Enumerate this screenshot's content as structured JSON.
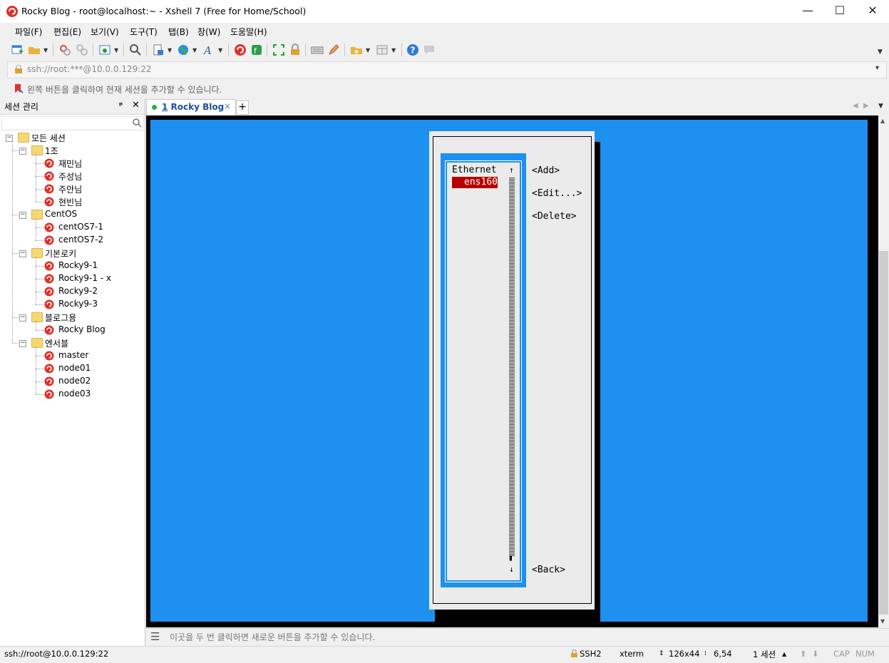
{
  "window": {
    "title": "Rocky Blog - root@localhost:~ - Xshell 7 (Free for Home/School)",
    "minimize": "—",
    "maximize": "☐",
    "close": "✕"
  },
  "menu": [
    "파일(F)",
    "편집(E)",
    "보기(V)",
    "도구(T)",
    "탭(B)",
    "창(W)",
    "도움말(H)"
  ],
  "address": {
    "value": "ssh://root:***@10.0.0.129:22",
    "dropdown": "▾"
  },
  "hint": {
    "text": "왼쪽 버튼을 클릭하여 현재 세션을 추가할 수 있습니다."
  },
  "session_panel": {
    "title": "세션 관리",
    "pin": "ᵖ",
    "close": "✕",
    "root": "모든 세션",
    "groups": [
      {
        "name": "1조",
        "items": [
          "재민님",
          "주성님",
          "주안님",
          "현빈님"
        ]
      },
      {
        "name": "CentOS",
        "items": [
          "centOS7-1",
          "centOS7-2"
        ]
      },
      {
        "name": "기본로키",
        "items": [
          "Rocky9-1",
          "Rocky9-1 - x",
          "Rocky9-2",
          "Rocky9-3"
        ]
      },
      {
        "name": "블로그용",
        "items": [
          "Rocky Blog"
        ]
      },
      {
        "name": "엔서블",
        "items": [
          "master",
          "node01",
          "node02",
          "node03"
        ]
      }
    ]
  },
  "tabs": {
    "active_number": "1",
    "active_label": "Rocky Blog",
    "close": "×",
    "add": "+"
  },
  "terminal": {
    "list_header": "Ethernet",
    "list_item": "ens160",
    "arrow_up": "↑",
    "arrow_down": "↓",
    "scroll_pos_char": "▮",
    "buttons": {
      "add": "<Add>",
      "edit": "<Edit...>",
      "delete": "<Delete>",
      "back": "<Back>"
    }
  },
  "input_bar": {
    "text": "이곳을 두 번 클릭하면 새로운 버튼을 추가할 수 있습니다."
  },
  "status": {
    "connection": "ssh://root@10.0.0.129:22",
    "protocol": "SSH2",
    "term": "xterm",
    "size": "126x44",
    "cursor": "6,54",
    "sessions": "1 세션",
    "cap": "CAP",
    "num": "NUM"
  },
  "colors": {
    "terminal_bg": "#1e90f0",
    "selected": "#b80000",
    "dialog": "#ebebeb"
  }
}
